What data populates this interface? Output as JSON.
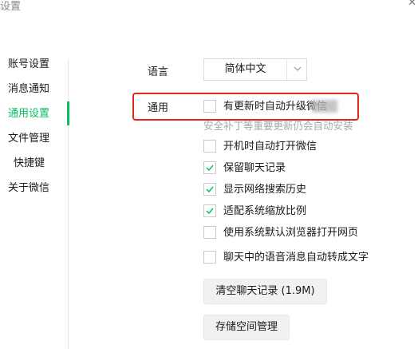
{
  "window": {
    "title": "设置",
    "close_glyph": "✕"
  },
  "sidebar": {
    "items": [
      {
        "label": "账号设置",
        "active": false
      },
      {
        "label": "消息通知",
        "active": false
      },
      {
        "label": "通用设置",
        "active": true
      },
      {
        "label": "文件管理",
        "active": false
      },
      {
        "label": "快捷键",
        "active": false
      },
      {
        "label": "关于微信",
        "active": false
      }
    ],
    "accent_color": "#07c160"
  },
  "general": {
    "language_label": "语言",
    "language_value": "简体中文",
    "section_label": "通用",
    "auto_update_label": "有更新时自动升级微信",
    "auto_update_checked": false,
    "auto_update_note": "安全补丁等重要更新仍会自动安装",
    "options": [
      {
        "label": "开机时自动打开微信",
        "checked": false
      },
      {
        "label": "保留聊天记录",
        "checked": true
      },
      {
        "label": "显示网络搜索历史",
        "checked": true
      },
      {
        "label": "适配系统缩放比例",
        "checked": true
      },
      {
        "label": "使用系统默认浏览器打开网页",
        "checked": false
      },
      {
        "label": "聊天中的语音消息自动转成文字",
        "checked": false
      }
    ],
    "clear_history_button": "清空聊天记录 (1.9M)",
    "storage_button": "存储空间管理"
  },
  "highlight_color": "#e3261a"
}
